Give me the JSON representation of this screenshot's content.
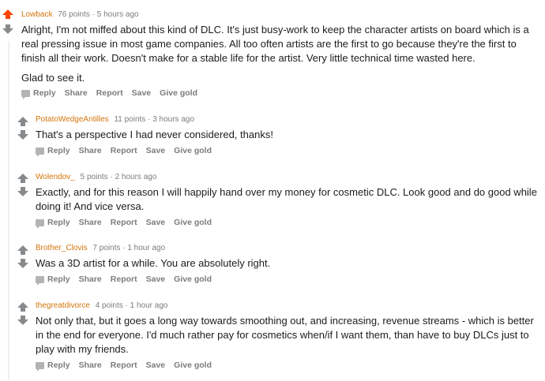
{
  "colors": {
    "upvote_active": "#ff4500",
    "upvote": "#878a8c",
    "author": "#d4750b",
    "meta": "#7c7c7c"
  },
  "icons": {
    "upvote": "up-arrow-icon",
    "downvote": "down-arrow-icon",
    "reply": "chat-bubble-icon"
  },
  "actions": {
    "reply": "Reply",
    "share": "Share",
    "report": "Report",
    "save": "Save",
    "give_gold": "Give gold"
  },
  "comments": [
    {
      "author": "Lowback",
      "points": "76 points",
      "sep": "·",
      "time": "5 hours ago",
      "upvoted": true,
      "paragraphs": [
        "Alright, I'm not miffed about this kind of DLC. It's just busy-work to keep the character artists on board which is a real pressing issue in most game companies. All too often artists are the first to go because they're the first to finish all their work. Doesn't make for a stable life for the artist. Very little technical time wasted here.",
        "Glad to see it."
      ]
    },
    {
      "author": "PotatoWedgeAntilles",
      "points": "11 points",
      "sep": "·",
      "time": "3 hours ago",
      "upvoted": false,
      "paragraphs": [
        "That's a perspective I had never considered, thanks!"
      ]
    },
    {
      "author": "Wolendov_",
      "points": "5 points",
      "sep": "·",
      "time": "2 hours ago",
      "upvoted": false,
      "paragraphs": [
        "Exactly, and for this reason I will happily hand over my money for cosmetic DLC. Look good and do good while doing it! And vice versa."
      ]
    },
    {
      "author": "Brother_Clovis",
      "points": "7 points",
      "sep": "·",
      "time": "1 hour ago",
      "upvoted": false,
      "paragraphs": [
        "Was a 3D artist for a while. You are absolutely right."
      ]
    },
    {
      "author": "thegreatdivorce",
      "points": "4 points",
      "sep": "·",
      "time": "1 hour ago",
      "upvoted": false,
      "paragraphs": [
        "Not only that, but it goes a long way towards smoothing out, and increasing, revenue streams - which is better in the end for everyone. I'd much rather pay for cosmetics when/if I want them, than have to buy DLCs just to play with my friends."
      ]
    }
  ]
}
